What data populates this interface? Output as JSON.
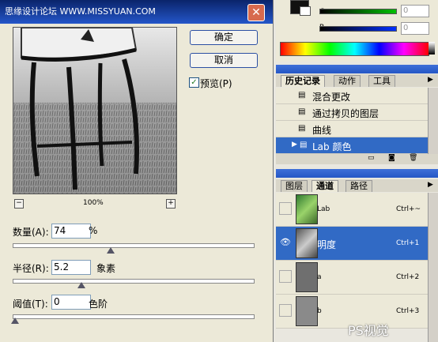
{
  "dialog": {
    "title": "思缘设计论坛 WWW.MISSYUAN.COM",
    "ok_label": "确定",
    "cancel_label": "取消",
    "preview_check": "✓",
    "preview_label": "预览(P)",
    "zoom_minus": "−",
    "zoom_plus": "+",
    "zoom_level": "100%",
    "amount": {
      "label": "数量(A):",
      "value": "74",
      "unit": "%",
      "level_percent": 40
    },
    "radius": {
      "label": "半径(R):",
      "value": "5.2",
      "unit": "象素",
      "level_percent": 28
    },
    "threshold": {
      "label": "阈值(T):",
      "value": "0",
      "unit": "色阶",
      "level_percent": 0
    }
  },
  "color": {
    "g_label": "G",
    "b_label": "B",
    "g_value": "0",
    "b_value": "0",
    "r_value": "0"
  },
  "history": {
    "tabs": [
      "历史记录",
      "动作",
      "工具"
    ],
    "items": [
      "混合更改",
      "通过拷贝的图层",
      "曲线",
      "Lab 颜色"
    ],
    "selected_index": 3
  },
  "channels": {
    "tabs": [
      "图层",
      "通道",
      "路径"
    ],
    "rows": [
      {
        "name": "Lab",
        "shortcut": "Ctrl+~"
      },
      {
        "name": "明度",
        "shortcut": "Ctrl+1"
      },
      {
        "name": "a",
        "shortcut": "Ctrl+2"
      },
      {
        "name": "b",
        "shortcut": "Ctrl+3"
      }
    ],
    "selected_index": 1
  },
  "watermark": "PS视觉",
  "colors": {
    "title_bar": "#0a246a",
    "selection": "#316ac5",
    "close_button": "#d76a4e"
  }
}
